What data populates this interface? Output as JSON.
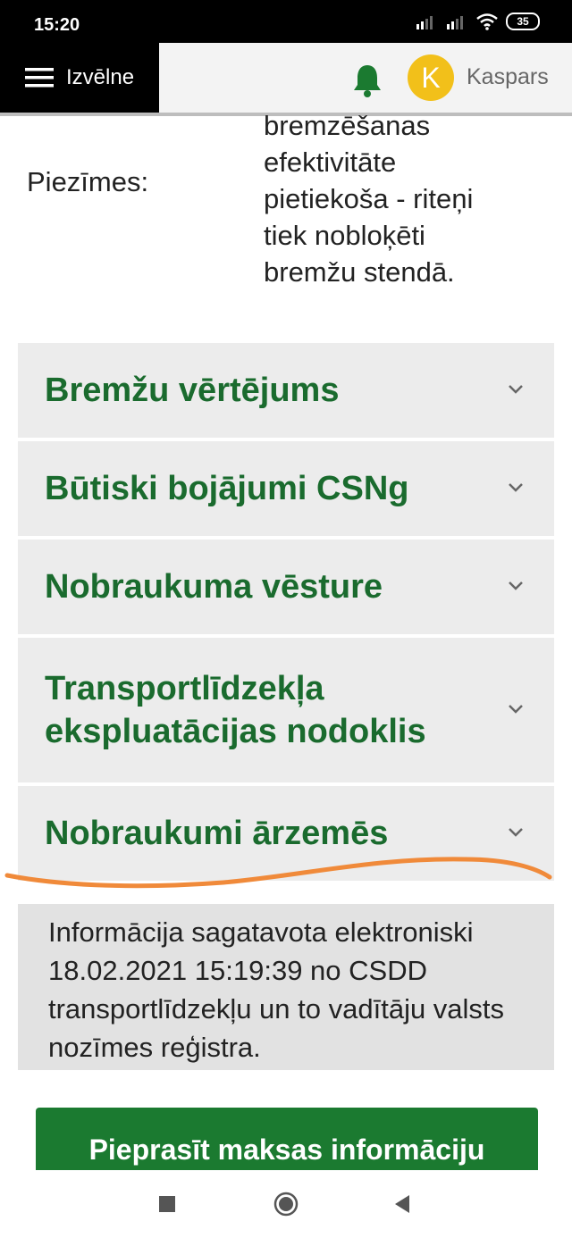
{
  "status_bar": {
    "time": "15:20",
    "battery": "35"
  },
  "header": {
    "menu_label": "Izvēlne",
    "avatar_initial": "K",
    "user_name": "Kaspars"
  },
  "notes": {
    "label": "Piezīmes:",
    "lines": [
      "bremzēšanas",
      "efektivitāte",
      "pietiekoša - riteņi",
      "tiek nobloķēti",
      "bremžu stendā."
    ]
  },
  "accordion": [
    {
      "title": "Bremžu vērtējums"
    },
    {
      "title": "Būtiski bojājumi CSNg"
    },
    {
      "title": "Nobraukuma vēsture"
    },
    {
      "title": "Transportlīdzekļa ekspluatācijas nodoklis"
    },
    {
      "title": "Nobraukumi ārzemēs"
    }
  ],
  "info": {
    "text": "Informācija sagatavota elektroniski 18.02.2021 15:19:39 no CSDD transportlīdzekļu un to vadītāju valsts nozīmes reģistra."
  },
  "cta": {
    "label": "Pieprasīt maksas informāciju"
  },
  "colors": {
    "accent_green": "#1a6b2e",
    "button_green": "#1b7a30",
    "avatar_yellow": "#f2c01a",
    "underline_orange": "#f08a3a"
  }
}
